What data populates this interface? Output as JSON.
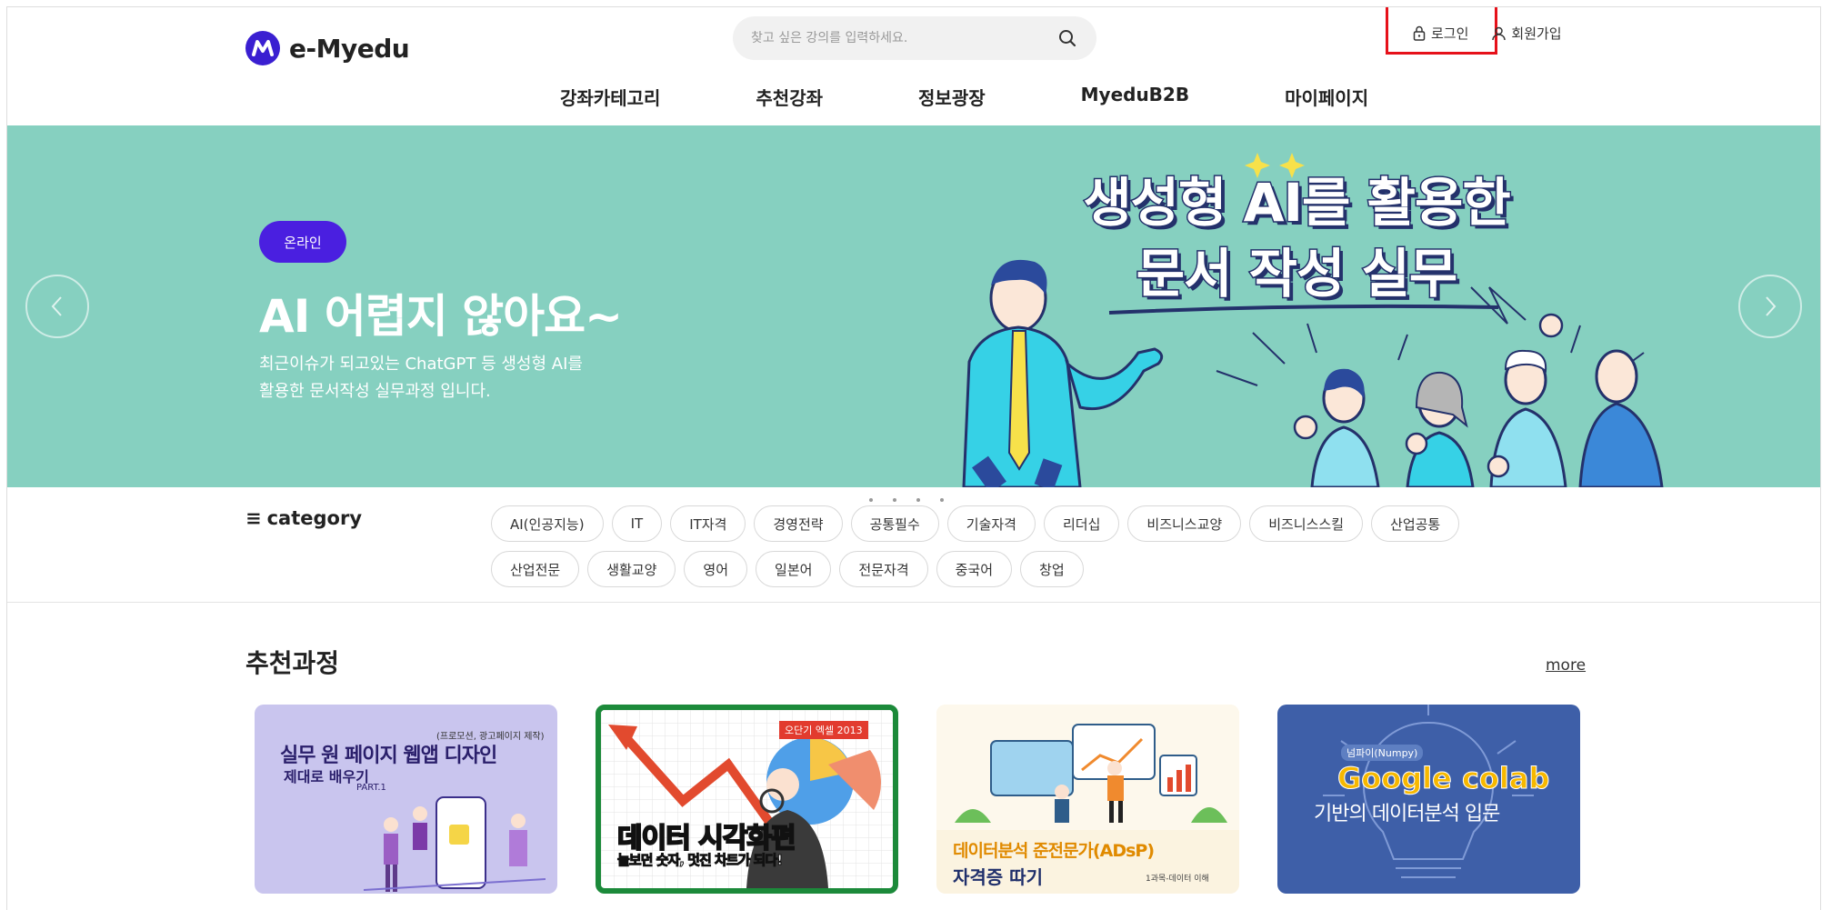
{
  "header": {
    "logo_text": "e-Myedu",
    "search_placeholder": "찾고 싶은 강의를 입력하세요.",
    "login_label": "로그인",
    "signup_label": "회원가입",
    "nav": [
      "강좌카테고리",
      "추천강좌",
      "정보광장",
      "MyeduB2B",
      "마이페이지"
    ]
  },
  "hero": {
    "badge": "온라인",
    "title": "AI 어렵지 않아요~",
    "desc_line1": "최근이슈가 되고있는 ChatGPT 등 생성형 AI를",
    "desc_line2": "활용한 문서작성 실무과정 입니다.",
    "headline_line1": "생성형 AI를 활용한",
    "headline_line2": "문서 작성 실무"
  },
  "category": {
    "label": "category",
    "chips": [
      "AI(인공지능)",
      "IT",
      "IT자격",
      "경영전략",
      "공통필수",
      "기술자격",
      "리더십",
      "비즈니스교양",
      "비즈니스스킬",
      "산업공통",
      "산업전문",
      "생활교양",
      "영어",
      "일본어",
      "전문자격",
      "중국어",
      "창업"
    ]
  },
  "recommended": {
    "title": "추천과정",
    "more": "more",
    "cards": [
      {
        "small": "(프로모션, 광고페이지 제작)",
        "main": "실무 원 페이지 웹앱 디자인",
        "sub": "제대로 배우기",
        "part": "PART.1"
      },
      {
        "tag": "오단기 엑셀 2013",
        "main": "데이터 시각화편",
        "sub": "늘보던 숫자, 멋진 차트가 되다!"
      },
      {
        "main": "데이터분석 준전문가(ADsP)",
        "sub": "자격증 따기",
        "small": "1과목-데이터 이해"
      },
      {
        "tag": "넘파이(Numpy)",
        "brand": "Google colab",
        "main": "기반의 데이터분석 입문"
      }
    ]
  },
  "colors": {
    "hero_bg": "#86d0c0",
    "accent_purple": "#4a1fe0",
    "highlight_red": "#e6111a"
  }
}
